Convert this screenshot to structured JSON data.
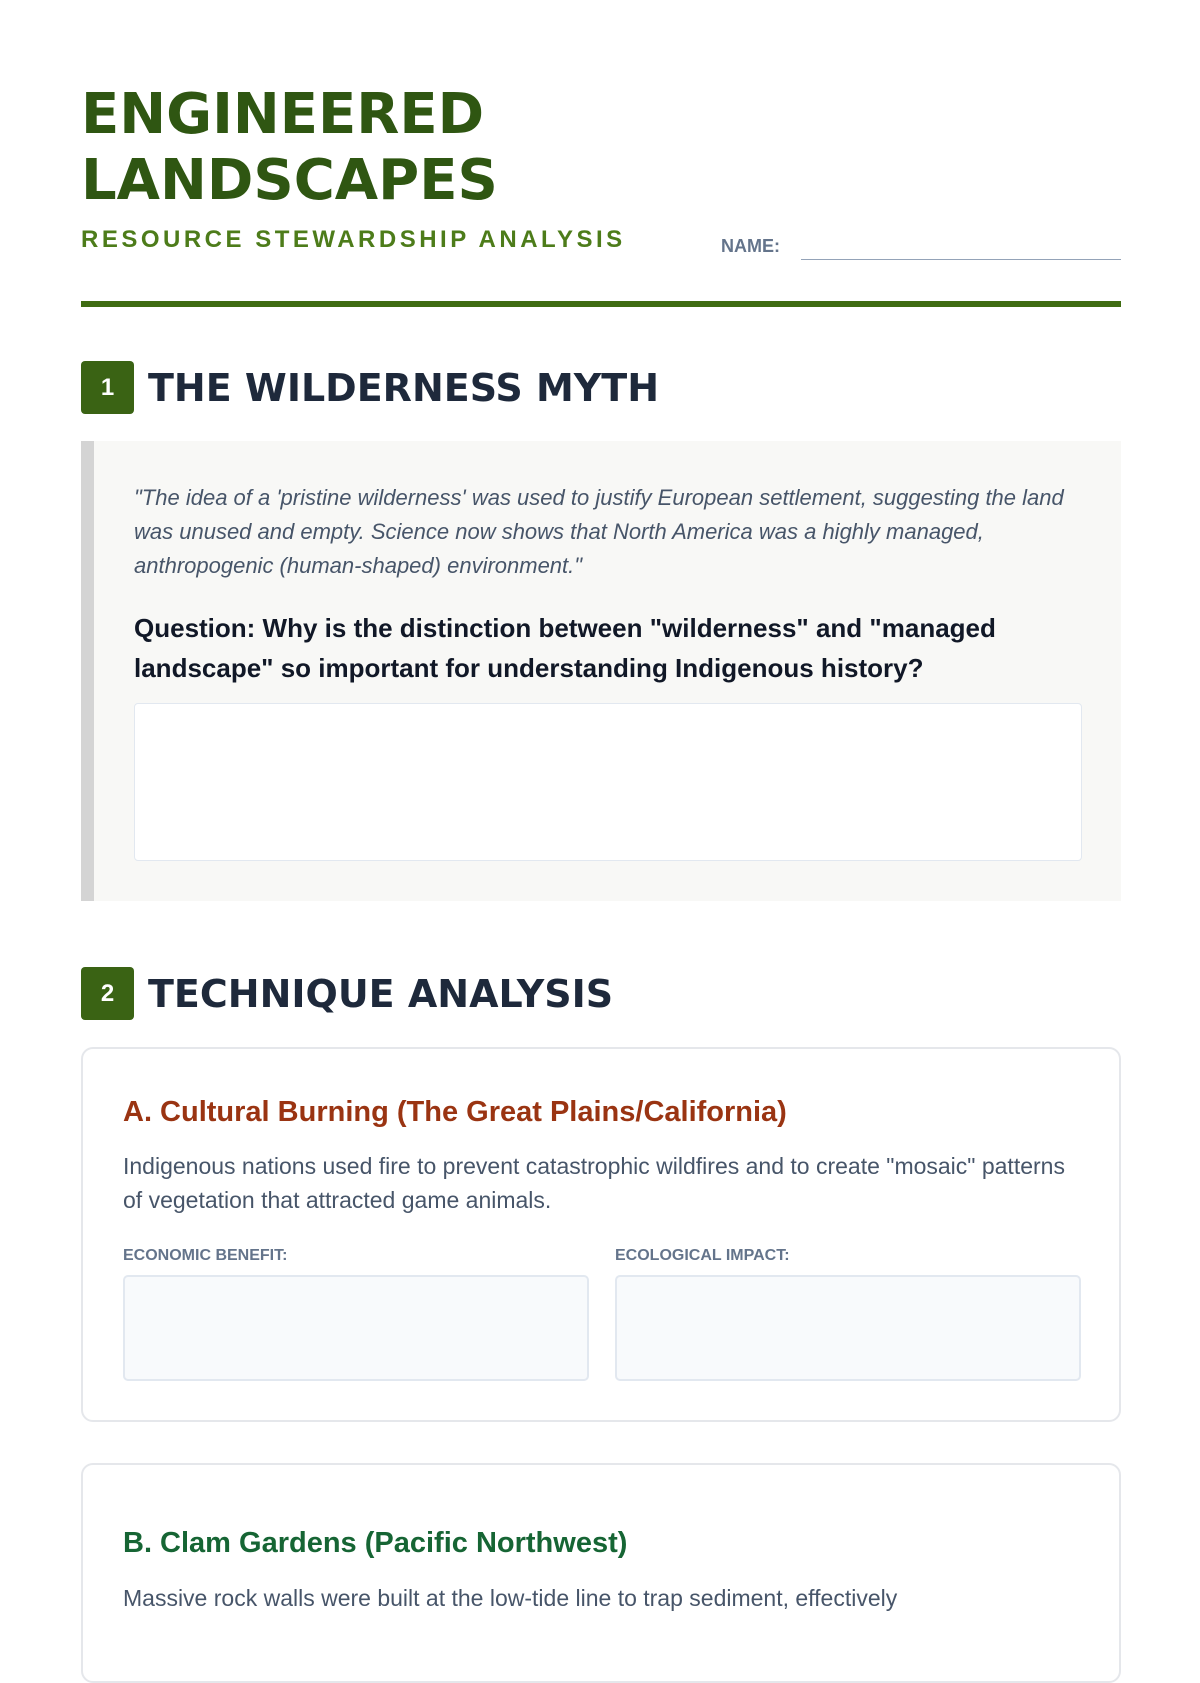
{
  "header": {
    "title_line1": "ENGINEERED",
    "title_line2": "LANDSCAPES",
    "subtitle": "RESOURCE STEWARDSHIP ANALYSIS",
    "name_label": "NAME:"
  },
  "section1": {
    "number": "1",
    "title": "THE WILDERNESS MYTH",
    "quote": "\"The idea of a 'pristine wilderness' was used to justify European settlement, suggesting the land was unused and empty. Science now shows that North America was a highly managed, anthropogenic (human-shaped) environment.\"",
    "question": "Question: Why is the distinction between \"wilderness\" and \"managed landscape\" so important for understanding Indigenous history?"
  },
  "section2": {
    "number": "2",
    "title": "TECHNIQUE ANALYSIS",
    "techniques": [
      {
        "title": "A. Cultural Burning (The Great Plains/California)",
        "description": "Indigenous nations used fire to prevent catastrophic wildfires and to create \"mosaic\" patterns of vegetation that attracted game animals.",
        "field1_label": "ECONOMIC BENEFIT:",
        "field2_label": "ECOLOGICAL IMPACT:"
      },
      {
        "title": "B. Clam Gardens (Pacific Northwest)",
        "description": "Massive rock walls were built at the low-tide line to trap sediment, effectively"
      }
    ]
  },
  "colors": {
    "brand_green": "#2f5612",
    "technique_a": "#9a3412",
    "technique_b": "#166534"
  }
}
